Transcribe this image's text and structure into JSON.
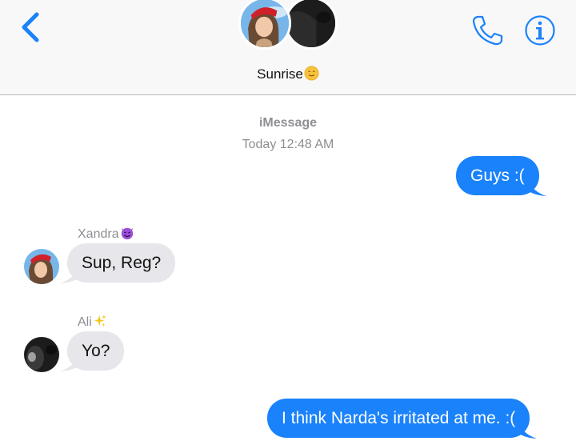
{
  "header": {
    "group_name": "Sunrise",
    "group_emoji": "smiling-sun-emoji",
    "back_icon": "chevron-left-icon",
    "phone_icon": "phone-icon",
    "info_icon": "info-icon"
  },
  "thread": {
    "service": "iMessage",
    "timestamp": "Today 12:48 AM"
  },
  "messages": [
    {
      "direction": "sent",
      "text": "Guys :("
    },
    {
      "direction": "received",
      "sender": "Xandra",
      "sender_emoji": "smiling-devil-emoji",
      "text": "Sup, Reg?"
    },
    {
      "direction": "received",
      "sender": "Ali",
      "sender_emoji": "sparkles-emoji",
      "text": "Yo?"
    },
    {
      "direction": "sent",
      "text": "I think Narda's irritated at me. :("
    }
  ],
  "colors": {
    "accent": "#1a82fb",
    "received_bubble": "#e6e6eb",
    "meta_text": "#8e8e93",
    "header_bg": "#f8f8f8"
  }
}
